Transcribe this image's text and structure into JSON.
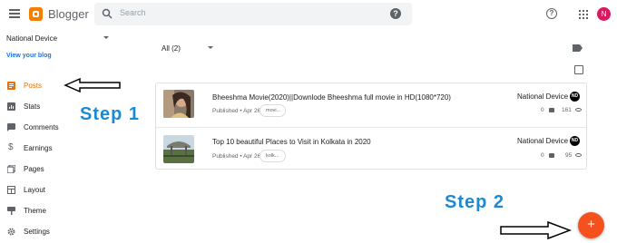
{
  "header": {
    "brand": "Blogger",
    "search_placeholder": "Search",
    "help_label": "?",
    "avatar_initial": "N"
  },
  "sidebar": {
    "blog_name": "National Device",
    "view_blog": "View your blog",
    "items": [
      {
        "label": "Posts",
        "icon": "posts-icon",
        "active": true
      },
      {
        "label": "Stats",
        "icon": "stats-icon"
      },
      {
        "label": "Comments",
        "icon": "comments-icon"
      },
      {
        "label": "Earnings",
        "icon": "dollar-icon"
      },
      {
        "label": "Pages",
        "icon": "pages-icon"
      },
      {
        "label": "Layout",
        "icon": "layout-icon"
      },
      {
        "label": "Theme",
        "icon": "theme-icon"
      },
      {
        "label": "Settings",
        "icon": "gear-icon"
      }
    ]
  },
  "annotations": {
    "step1": "Step 1",
    "step2": "Step 2"
  },
  "main": {
    "filter": "All (2)",
    "posts": [
      {
        "title": "Bheeshma Movie(2020)||Downlode Bheeshma full movie in HD(1080*720)",
        "status": "Published • Apr 26",
        "label_chip": "movi...",
        "author": "National Device",
        "author_badge": "ND",
        "comments": "0",
        "views": "161"
      },
      {
        "title": "Top 10 beautiful Places to Visit in Kolkata in 2020",
        "status": "Published • Apr 26",
        "label_chip": "kolk...",
        "author": "National Device",
        "author_badge": "ND",
        "comments": "0",
        "views": "95"
      }
    ],
    "fab_label": "+"
  },
  "colors": {
    "accent": "#e8710a",
    "fab": "#f4511e",
    "link": "#1a73e8",
    "step_text": "#1a8ad4"
  }
}
